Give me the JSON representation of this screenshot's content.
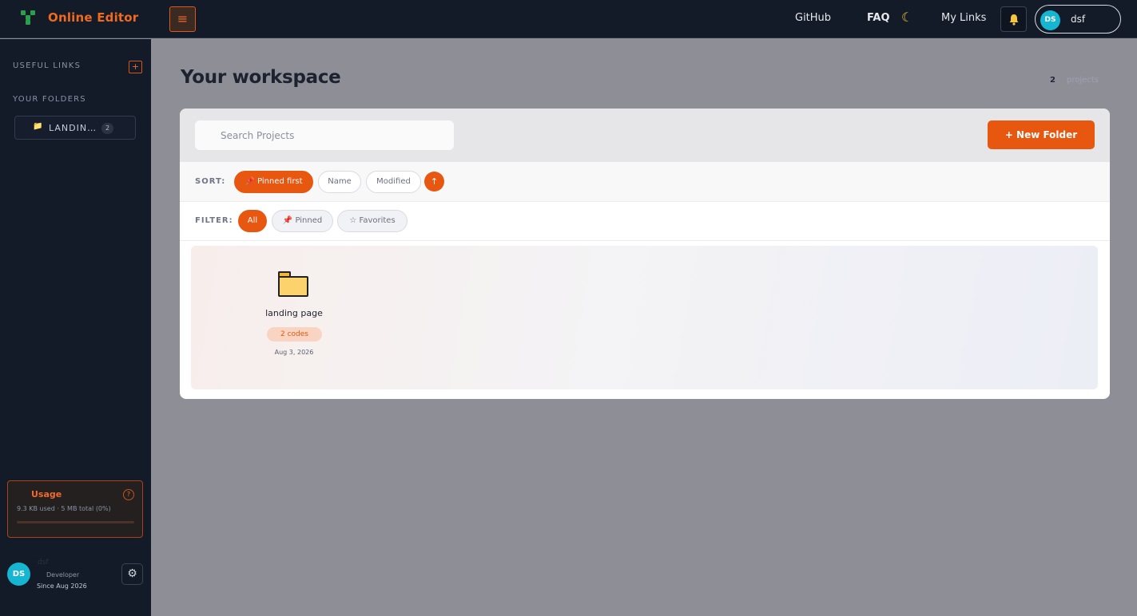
{
  "app": {
    "brand": "Online Editor",
    "menu_icon": "hamburger-icon",
    "accent": "#e8570f"
  },
  "nav": {
    "links": [
      "GitHub",
      "FAQ",
      "My Links"
    ],
    "theme_icon": "moon-icon",
    "notification_icon": "bell-icon",
    "user": {
      "initials": "DS",
      "name": "dsf"
    }
  },
  "sidebar": {
    "useful_links_heading": "USEFUL LINKS",
    "add_link_label": "+",
    "folders_heading": "YOUR FOLDERS",
    "folders": [
      {
        "label": "LANDIN…",
        "count": "2"
      }
    ],
    "usage": {
      "title": "Usage",
      "help_label": "?",
      "detail": "9.3 KB used · 5 MB total (0%)",
      "fraction_used": 0
    },
    "profile": {
      "initials": "DS",
      "name": "dsf",
      "role": "Developer",
      "since": "Since Aug 2026"
    }
  },
  "main": {
    "title": "Your workspace",
    "project_count": "2",
    "project_count_label": "projects",
    "search": {
      "placeholder": "Search Projects",
      "value": ""
    },
    "new_folder_label": "+ New Folder",
    "sort": {
      "label": "SORT:",
      "options": [
        "Pinned first",
        "Name",
        "Modified"
      ],
      "active": "Pinned first",
      "direction_icon": "arrow-up-icon"
    },
    "filter": {
      "label": "FILTER:",
      "options": [
        "All",
        "Pinned",
        "Favorites"
      ],
      "active": "All"
    },
    "folders": [
      {
        "name": "landing page",
        "badge": "2 codes",
        "date": "Aug 3, 2026",
        "icon": "folder-icon"
      }
    ]
  }
}
